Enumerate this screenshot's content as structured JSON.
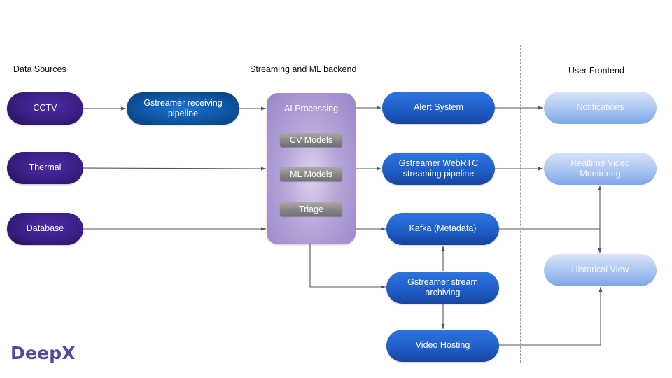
{
  "sections": {
    "data_sources": "Data Sources",
    "backend": "Streaming and ML backend",
    "frontend": "User Frontend"
  },
  "sources": [
    {
      "id": "cctv",
      "label": "CCTV"
    },
    {
      "id": "thermal",
      "label": "Thermal"
    },
    {
      "id": "database",
      "label": "Database"
    }
  ],
  "backend": {
    "receiving": "Gstreamer receiving pipeline",
    "ai": {
      "title": "AI Processing",
      "modules": [
        "CV Models",
        "ML Models",
        "Triage"
      ]
    },
    "alert": "Alert System",
    "webrtc": "Gstreamer WebRTC streaming pipeline",
    "kafka": "Kafka (Metadata)",
    "archiving": "Gstreamer stream archiving",
    "hosting": "Video Hosting"
  },
  "frontend": {
    "notifications": "Notifications",
    "realtime": "Realtime Video Monitoring",
    "historical": "Historical View"
  },
  "edges": [
    {
      "from": "CCTV",
      "to": "Gstreamer receiving pipeline"
    },
    {
      "from": "Gstreamer receiving pipeline",
      "to": "AI Processing"
    },
    {
      "from": "Thermal",
      "to": "AI Processing"
    },
    {
      "from": "Database",
      "to": "AI Processing"
    },
    {
      "from": "AI Processing",
      "to": "Alert System"
    },
    {
      "from": "AI Processing",
      "to": "Gstreamer WebRTC streaming pipeline"
    },
    {
      "from": "AI Processing",
      "to": "Kafka (Metadata)"
    },
    {
      "from": "AI Processing",
      "to": "Gstreamer stream archiving"
    },
    {
      "from": "Gstreamer stream archiving",
      "to": "Kafka (Metadata)"
    },
    {
      "from": "Gstreamer stream archiving",
      "to": "Video Hosting"
    },
    {
      "from": "Alert System",
      "to": "Notifications"
    },
    {
      "from": "Gstreamer WebRTC streaming pipeline",
      "to": "Realtime Video Monitoring"
    },
    {
      "from": "Kafka (Metadata)",
      "to": "Realtime Video Monitoring"
    },
    {
      "from": "Kafka (Metadata)",
      "to": "Historical View"
    },
    {
      "from": "Video Hosting",
      "to": "Historical View"
    }
  ],
  "logo": "DeepX",
  "colors": {
    "source": "#3a1f85",
    "backend": "#1f5cc4",
    "ai": "#b6a3d8",
    "frontend": "#a9c4f0",
    "logo": "#5447a6",
    "edge": "#555555"
  }
}
